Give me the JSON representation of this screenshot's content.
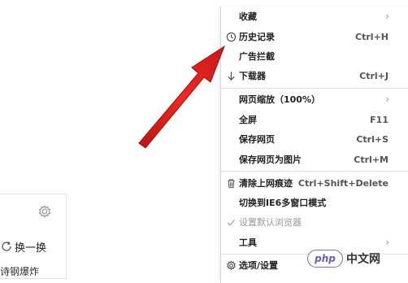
{
  "menu": {
    "items": [
      {
        "label": "收藏",
        "shortcut": "",
        "submenu": true,
        "icon": ""
      },
      {
        "label": "历史记录",
        "shortcut": "Ctrl+H",
        "submenu": false,
        "icon": "clock-icon"
      },
      {
        "label": "广告拦截",
        "shortcut": "",
        "submenu": false,
        "icon": ""
      },
      {
        "label": "下载器",
        "shortcut": "Ctrl+J",
        "submenu": false,
        "icon": "download-arrow-icon"
      },
      {
        "label": "网页缩放（100%）",
        "shortcut": "",
        "submenu": true,
        "icon": ""
      },
      {
        "label": "全屏",
        "shortcut": "F11",
        "submenu": false,
        "icon": ""
      },
      {
        "label": "保存网页",
        "shortcut": "Ctrl+S",
        "submenu": false,
        "icon": ""
      },
      {
        "label": "保存网页为图片",
        "shortcut": "Ctrl+M",
        "submenu": false,
        "icon": ""
      },
      {
        "label": "清除上网痕迹",
        "shortcut": "Ctrl+Shift+Delete",
        "submenu": false,
        "icon": "trash-icon"
      },
      {
        "label": "切换到IE6多窗口模式",
        "shortcut": "",
        "submenu": false,
        "icon": ""
      },
      {
        "label": "设置默认浏览器",
        "shortcut": "",
        "submenu": false,
        "icon": "check-icon",
        "disabled": true
      },
      {
        "label": "工具",
        "shortcut": "",
        "submenu": true,
        "icon": ""
      },
      {
        "label": "选项/设置",
        "shortcut": "",
        "submenu": false,
        "icon": "gear-icon"
      }
    ],
    "submenu_arrow": "›"
  },
  "background": {
    "refresh_label": "换一换",
    "news_snippet": "诗钢爆炸"
  },
  "watermark": {
    "logo_text": "php",
    "site_text": "中文网"
  },
  "colors": {
    "annotation_arrow": "#e0201e",
    "disabled_text": "#9a9a9a",
    "separator": "#e3e3e3"
  }
}
